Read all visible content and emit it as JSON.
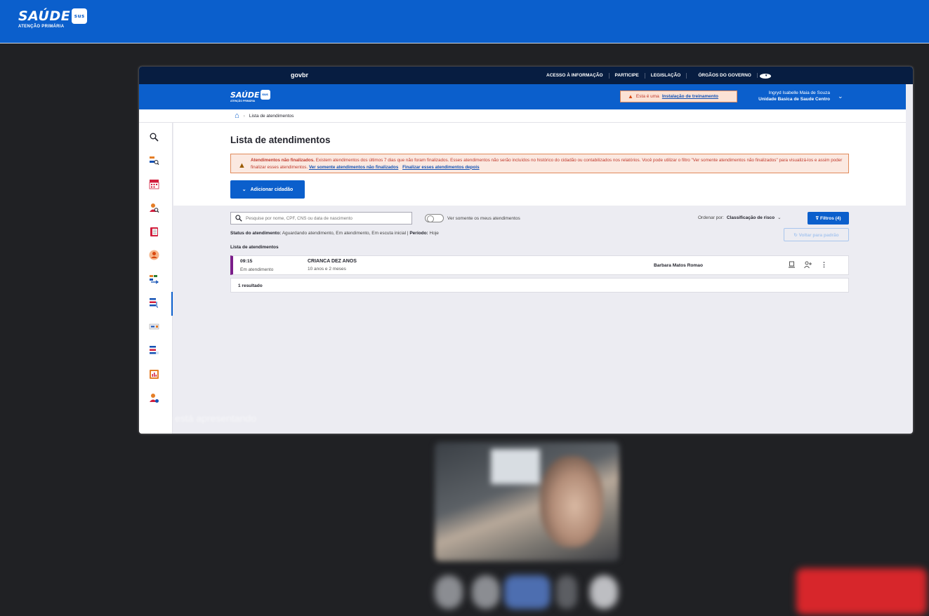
{
  "outer": {
    "brand": "SAÚDE",
    "badge": "sus",
    "subtitle": "ATENÇÃO PRIMÁRIA"
  },
  "gov": {
    "logo": "govbr",
    "links": [
      "ACESSO À INFORMAÇÃO",
      "PARTICIPE",
      "LEGISLAÇÃO",
      "ÓRGÃOS DO GOVERNO"
    ]
  },
  "header": {
    "brand": "SAÚDE",
    "badge": "sus",
    "subtitle": "ATENÇÃO PRIMÁRIA",
    "training_prefix": "Esta é uma",
    "training_link": "Instalação de treinamento",
    "user_name": "Ingryd Isabelle Maia de Souza",
    "user_unit": "Unidade Basica de Saude Centro"
  },
  "breadcrumb": {
    "current": "Lista de atendimentos"
  },
  "page": {
    "title": "Lista de atendimentos",
    "alert_bold": "Atendimentos não finalizados.",
    "alert_text": "Existem atendimentos dos últimos 7 dias que não foram finalizados. Esses atendimentos não serão incluídos no histórico do cidadão ou contabilizados nos relatórios. Você pode utilizar o filtro \"Ver somente atendimentos não finalizados\" para visualizá-los e assim poder finalizar esses atendimentos.",
    "alert_link1": "Ver somente atendimentos não finalizados",
    "alert_link2": "Finalizar esses atendimentos depois",
    "add_button": "Adicionar cidadão"
  },
  "filters": {
    "search_placeholder": "Pesquise por nome, CPF, CNS ou data de nascimento",
    "toggle_label": "Ver somente os meus atendimentos",
    "order_label": "Ordenar por:",
    "order_value": "Classificação de risco",
    "filter_button": "Filtros (4)",
    "status_label": "Status do atendimento:",
    "status_value": "Aguardando atendimento, Em atendimento, Em escuta inicial",
    "period_label": "Período:",
    "period_value": "Hoje",
    "reset_button": "Voltar para padrão",
    "list_label": "Lista de atendimentos"
  },
  "rows": [
    {
      "time": "09:15",
      "state": "Em atendimento",
      "name": "CRIANCA DEZ ANOS",
      "age": "10 anos e 2 meses",
      "professional": "Barbara Matos Romao"
    }
  ],
  "result_count": "1 resultado",
  "presenting": "Você está apresentando",
  "colors": {
    "primary": "#0b5fcc",
    "gov_bar": "#071d41",
    "risk_stripe": "#7b1e8a",
    "alert_bg": "#fbe9e1"
  }
}
